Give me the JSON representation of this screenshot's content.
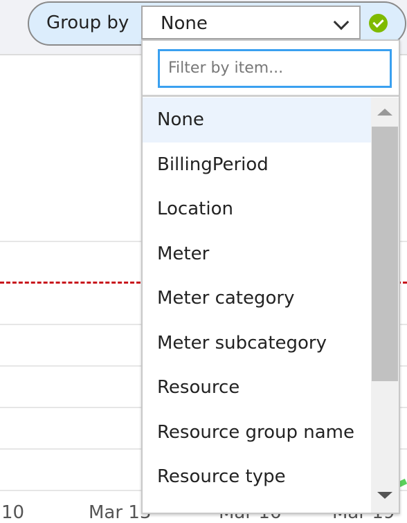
{
  "group_by": {
    "label": "Group by",
    "selected": "None",
    "status_icon": "check-circle-icon",
    "status_color": "#7fba00"
  },
  "dropdown": {
    "filter_placeholder": "Filter by item...",
    "items": [
      "None",
      "BillingPeriod",
      "Location",
      "Meter",
      "Meter category",
      "Meter subcategory",
      "Resource",
      "Resource group name",
      "Resource type"
    ],
    "selected_index": 0
  },
  "chart": {
    "x_ticks": [
      "10",
      "Mar 13",
      "Mar 16",
      "Mar 19"
    ],
    "budget_line_color": "#c8161d"
  }
}
